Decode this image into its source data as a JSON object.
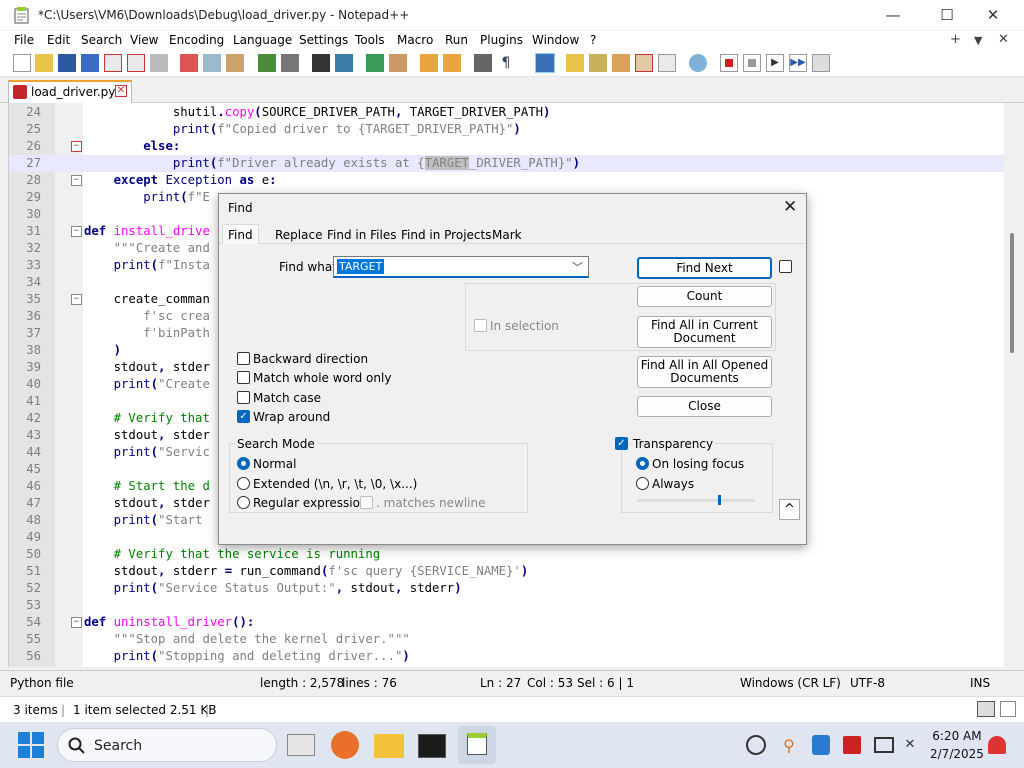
{
  "window": {
    "title": "*C:\\Users\\VM6\\Downloads\\Debug\\load_driver.py - Notepad++",
    "minimize": "—",
    "maximize": "☐",
    "close": "✕"
  },
  "menu": {
    "items": [
      "File",
      "Edit",
      "Search",
      "View",
      "Encoding",
      "Language",
      "Settings",
      "Tools",
      "Macro",
      "Run",
      "Plugins",
      "Window",
      "?"
    ],
    "right": [
      "+",
      "▼",
      "✕"
    ]
  },
  "tab": {
    "label": "load_driver.py",
    "close": "✕"
  },
  "editor": {
    "lines": [
      {
        "n": "24",
        "text": "            shutil.copy(SOURCE_DRIVER_PATH, TARGET_DRIVER_PATH)"
      },
      {
        "n": "25",
        "text": "            print(f\"Copied driver to {TARGET_DRIVER_PATH}\")"
      },
      {
        "n": "26",
        "text": "        else:"
      },
      {
        "n": "27",
        "text": "            print(f\"Driver already exists at {TARGET_DRIVER_PATH}\")"
      },
      {
        "n": "28",
        "text": "    except Exception as e:"
      },
      {
        "n": "29",
        "text": "        print(f\"E"
      },
      {
        "n": "30",
        "text": ""
      },
      {
        "n": "31",
        "text": "def install_drive"
      },
      {
        "n": "32",
        "text": "    \"\"\"Create and"
      },
      {
        "n": "33",
        "text": "    print(f\"Insta"
      },
      {
        "n": "34",
        "text": ""
      },
      {
        "n": "35",
        "text": "    create_comman"
      },
      {
        "n": "36",
        "text": "        f'sc crea"
      },
      {
        "n": "37",
        "text": "        f'binPath"
      },
      {
        "n": "38",
        "text": "    )"
      },
      {
        "n": "39",
        "text": "    stdout, stder"
      },
      {
        "n": "40",
        "text": "    print(\"Create"
      },
      {
        "n": "41",
        "text": ""
      },
      {
        "n": "42",
        "text": "    # Verify that"
      },
      {
        "n": "43",
        "text": "    stdout, stder"
      },
      {
        "n": "44",
        "text": "    print(\"Servic"
      },
      {
        "n": "45",
        "text": ""
      },
      {
        "n": "46",
        "text": "    # Start the d"
      },
      {
        "n": "47",
        "text": "    stdout, stder"
      },
      {
        "n": "48",
        "text": "    print(\"Start"
      },
      {
        "n": "49",
        "text": ""
      },
      {
        "n": "50",
        "text": "    # Verify that the service is running"
      },
      {
        "n": "51",
        "text": "    stdout, stderr = run_command(f'sc query {SERVICE_NAME}')"
      },
      {
        "n": "52",
        "text": "    print(\"Service Status Output:\", stdout, stderr)"
      },
      {
        "n": "53",
        "text": ""
      },
      {
        "n": "54",
        "text": "def uninstall_driver():"
      },
      {
        "n": "55",
        "text": "    \"\"\"Stop and delete the kernel driver.\"\"\""
      },
      {
        "n": "56",
        "text": "    print(\"Stopping and deleting driver...\")"
      }
    ]
  },
  "status": {
    "type": "Python file",
    "length": "length : 2,578",
    "lines": "lines : 76",
    "ln": "Ln : 27",
    "col": "Col : 53",
    "sel": "Sel : 6 | 1",
    "eol": "Windows (CR LF)",
    "enc": "UTF-8",
    "ins": "INS"
  },
  "explorer": {
    "items": "3 items",
    "sep": "|",
    "selected": "1 item selected  2.51 KB",
    "sep2": "|"
  },
  "taskbar": {
    "search": "Search",
    "time": "6:20 AM",
    "date": "2/7/2025"
  },
  "find": {
    "title": "Find",
    "close": "✕",
    "tabs": [
      "Find",
      "Replace",
      "Find in Files",
      "Find in Projects",
      "Mark"
    ],
    "find_what_label": "Find what:",
    "find_what_value": "TARGET",
    "buttons": {
      "find_next": "Find Next",
      "count": "Count",
      "find_all_current_1": "Find All in Current",
      "find_all_current_2": "Document",
      "find_all_opened_1": "Find All in All Opened",
      "find_all_opened_2": "Documents",
      "close": "Close"
    },
    "in_selection": "In selection",
    "options": {
      "backward": "Backward direction",
      "whole_word": "Match whole word only",
      "match_case": "Match case",
      "wrap_around": "Wrap around"
    },
    "search_mode": {
      "label": "Search Mode",
      "normal": "Normal",
      "extended": "Extended (\\n, \\r, \\t, \\0, \\x...)",
      "regex": "Regular expression",
      "matches_newline": ". matches newline"
    },
    "transparency": {
      "label": "Transparency",
      "on_losing_focus": "On losing focus",
      "always": "Always",
      "level": 0.7
    },
    "collapse": "^"
  },
  "colors": {
    "accent": "#0067c0",
    "keyword": "#00008b",
    "function": "#ff00ff",
    "comment": "#008000",
    "string": "#808080"
  }
}
